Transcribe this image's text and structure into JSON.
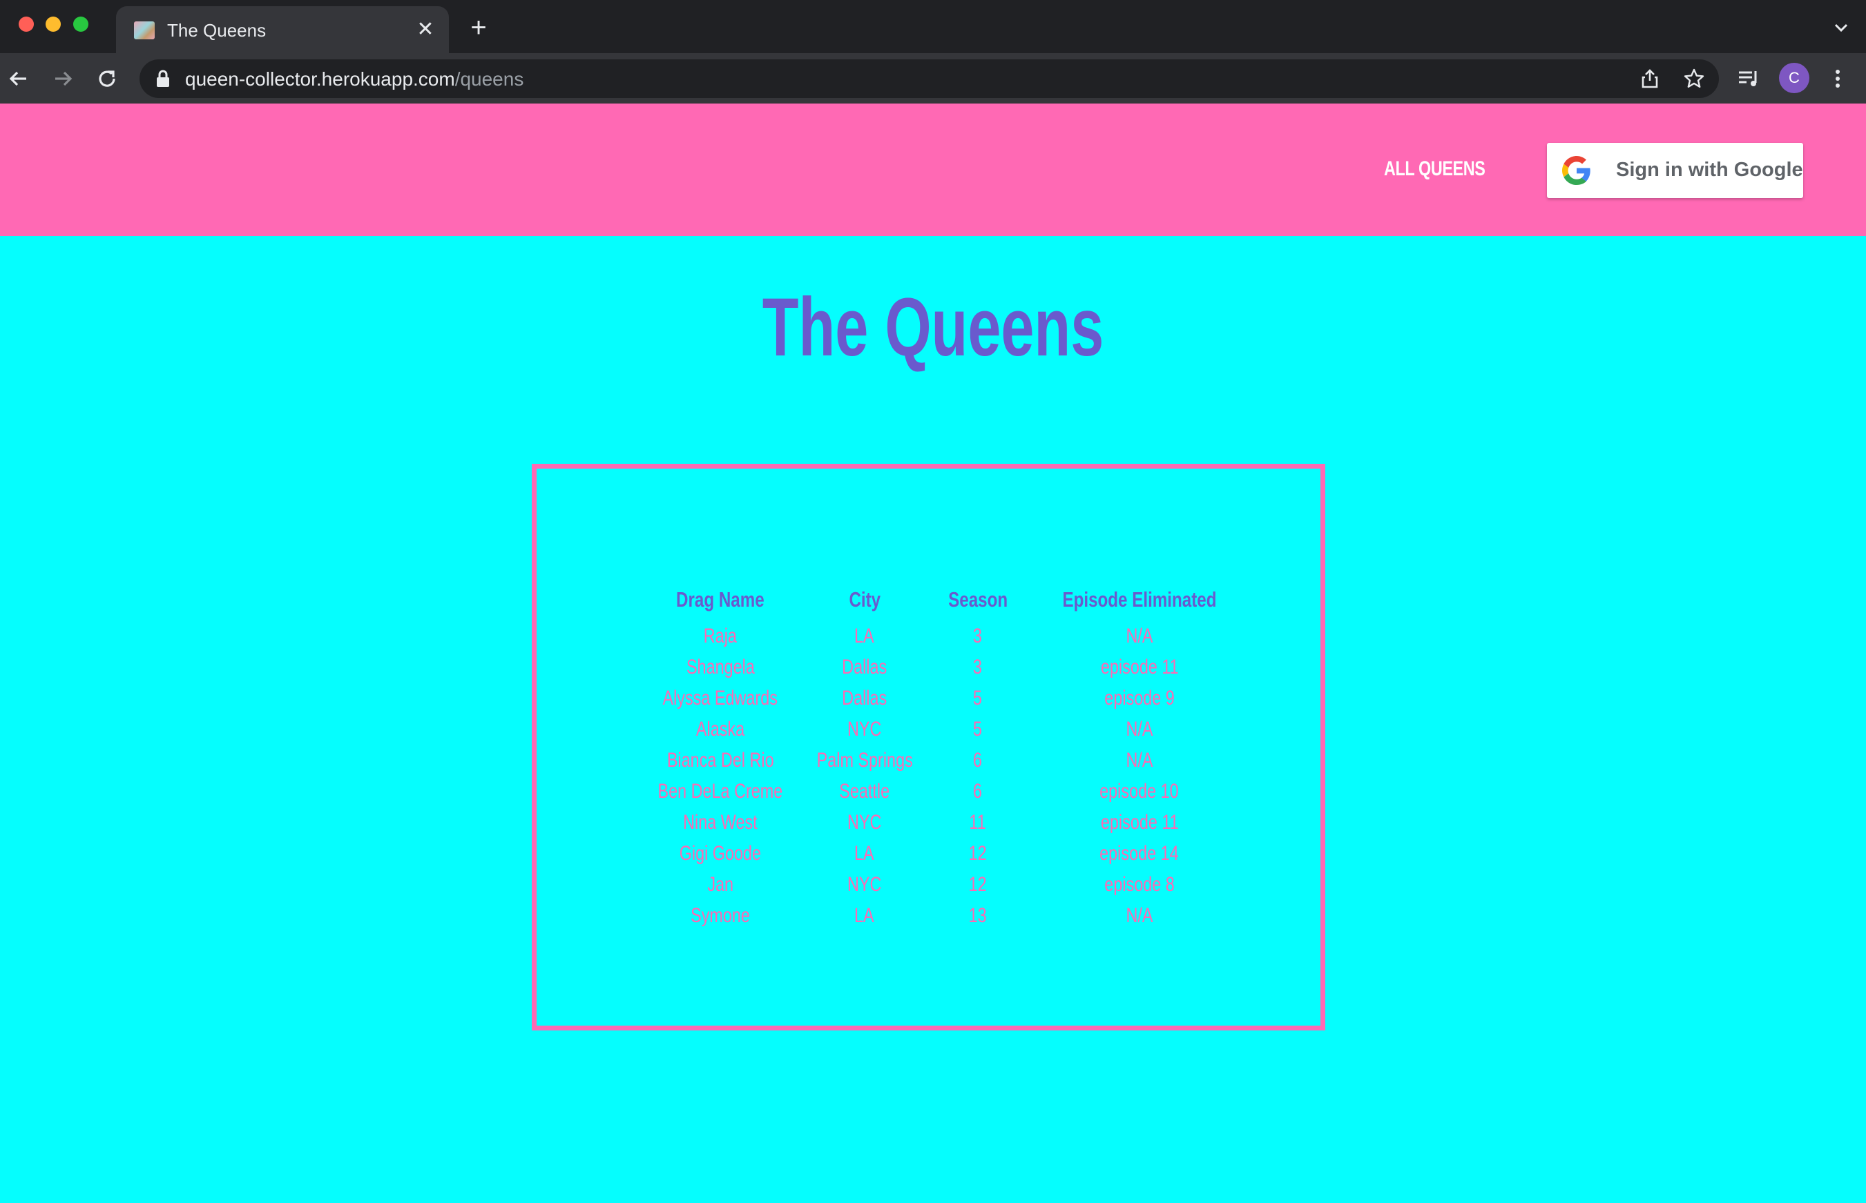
{
  "browser": {
    "tab": {
      "title": "The Queens",
      "close_glyph": "✕"
    },
    "new_tab_glyph": "+",
    "url": {
      "host": "queen-collector.herokuapp.com",
      "path": "/queens"
    },
    "profile_initial": "C"
  },
  "navbar": {
    "all_queens_label": "ALL QUEENS",
    "google_signin_label": "Sign in with Google",
    "background_color": "#ff69b4"
  },
  "main": {
    "title": "The Queens",
    "background_color": "#05fefe",
    "accent_color": "#6a5acd",
    "table": {
      "headers": [
        "Drag Name",
        "City",
        "Season",
        "Episode Eliminated"
      ],
      "rows": [
        [
          "Raja",
          "LA",
          "3",
          "N/A"
        ],
        [
          "Shangela",
          "Dallas",
          "3",
          "episode 11"
        ],
        [
          "Alyssa Edwards",
          "Dallas",
          "5",
          "episode 9"
        ],
        [
          "Alaska",
          "NYC",
          "5",
          "N/A"
        ],
        [
          "Bianca Del Rio",
          "Palm Springs",
          "6",
          "N/A"
        ],
        [
          "Ben DeLa Creme",
          "Seattle",
          "6",
          "episode 10"
        ],
        [
          "Nina West",
          "NYC",
          "11",
          "episode 11"
        ],
        [
          "Gigi Goode",
          "LA",
          "12",
          "episode 14"
        ],
        [
          "Jan",
          "NYC",
          "12",
          "episode 8"
        ],
        [
          "Symone",
          "LA",
          "13",
          "N/A"
        ]
      ]
    }
  }
}
